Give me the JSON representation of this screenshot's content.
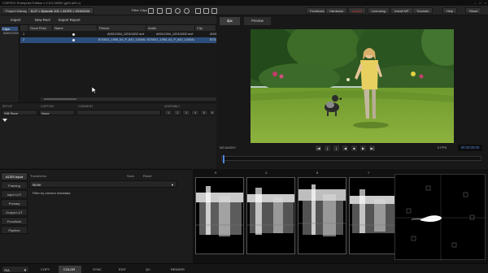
{
  "titlebar": {
    "title": "CORTEX Enterprise Edition v 2.5.0.00000 (g00.a00.c)"
  },
  "window_controls": {
    "minimize": "–",
    "maximize": "□",
    "close": "×"
  },
  "menubar": {
    "project_manager": "Project Manager",
    "project_path": "ILLF > Episode 101 > ACES > 20161104",
    "filter_clips": "Filter Clips",
    "right_items": [
      "Feedback",
      "Hardware",
      "Log-IO",
      "Licensing",
      "Install MP",
      "Tutorials",
      "Help",
      "Reset"
    ]
  },
  "toolbar": {
    "import": "Import",
    "new_reel": "New Reel",
    "export_report": "Export Report"
  },
  "sidebar": {
    "items": [
      "Clips",
      "A001C004"
    ]
  },
  "table": {
    "columns": [
      "",
      "Good Fluid",
      "Name",
      "Picture",
      "Audio",
      "Clip"
    ],
    "rows": [
      {
        "num": "1",
        "good": true,
        "name": "",
        "picture": "A001C004_120104GZ.mxf",
        "audio": "A001C004_120104GZ.mxf",
        "clip": "A001"
      },
      {
        "num": "2",
        "good": true,
        "name": "",
        "picture": "B75S01_1996_04_P_840_1000AVCV",
        "audio": "B75S01_1996_04_P_840_1000AVCV",
        "clip": "B753"
      }
    ]
  },
  "metadata": {
    "labels": {
      "setup": "SETUP",
      "caption": "CAPTION",
      "comment": "COMMENT",
      "assembly": "ASSEMBLY"
    },
    "setup_value": "Still Store",
    "caption_value": "None",
    "numbers": [
      "1",
      "2",
      "3",
      "4",
      "5",
      "6"
    ]
  },
  "viewer": {
    "tabs": [
      "dpx",
      "Preview"
    ],
    "audio_status": "NO AUDIO",
    "fps": "0 FPS",
    "timecode": "00:00:00:00",
    "transport": [
      "|◀",
      "[",
      "]",
      "◀",
      "■",
      "▶",
      "▶|"
    ]
  },
  "grading": {
    "tabs": [
      "ACES Input",
      "Framing",
      "Input LUT",
      "Primary",
      "Output LUT",
      "Functions",
      "Pipeline"
    ],
    "section_title": "Transforms",
    "save": "Save",
    "reset": "Reset",
    "transform_value": "None",
    "filter_label": "Filter by camera metadata"
  },
  "scopes": {
    "channel_labels": [
      "R",
      "G",
      "B",
      "Y"
    ]
  },
  "bottom_bar": {
    "dropdown_value": "ALL",
    "tabs": [
      "COPY",
      "COLOR",
      "SYNC",
      "EDIT",
      "QC",
      "RENDER"
    ],
    "active_tab": "COLOR"
  },
  "colors": {
    "accent": "#4f86d8",
    "selection": "#2d4e7a",
    "alert": "#d03030"
  }
}
